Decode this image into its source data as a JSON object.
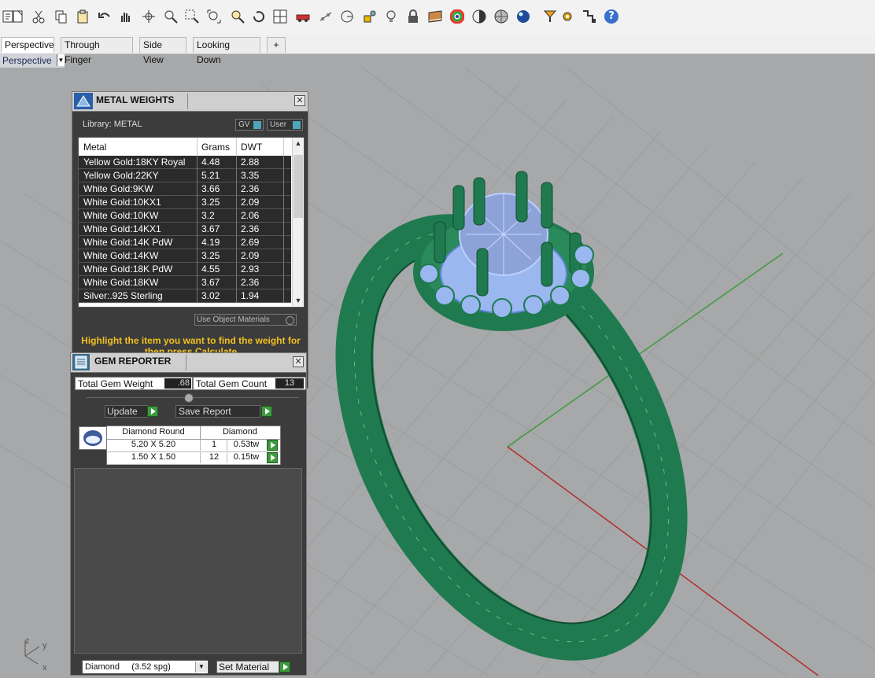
{
  "toolbar": {
    "icons": [
      "new-file-icon",
      "cut-icon",
      "copy-icon",
      "paste-icon",
      "undo-icon",
      "pan-icon",
      "rotate-icon",
      "zoom-icon",
      "zoom-window-icon",
      "zoom-extents-icon",
      "zoom-selected-icon",
      "rotate-view-icon",
      "grid-viewports-icon",
      "car-icon",
      "points-icon",
      "circle-icon",
      "shapes-icon",
      "lock-icon",
      "light-icon",
      "book-icon",
      "color-wheel-icon",
      "shade-icon",
      "render-sphere-icon",
      "gem-sphere-icon",
      "options-icon",
      "gear-icon",
      "flow-icon",
      "help-icon"
    ],
    "help_glyph": "?"
  },
  "tabs": [
    "Perspective",
    "Through Finger",
    "Side View",
    "Looking Down"
  ],
  "add_tab_glyph": "+",
  "viewport": {
    "label": "Perspective",
    "axis_y": "y",
    "axis_x": "x",
    "axis_z": "z"
  },
  "metal_weights": {
    "title": "METAL WEIGHTS",
    "library_label": "Library: METAL",
    "gv_label": "GV",
    "user_label": "User",
    "columns": [
      "Metal",
      "Grams",
      "DWT"
    ],
    "rows": [
      {
        "metal": "Yellow Gold:18KY Royal",
        "grams": "4.48",
        "dwt": "2.88"
      },
      {
        "metal": "Yellow Gold:22KY",
        "grams": "5.21",
        "dwt": "3.35"
      },
      {
        "metal": "White Gold:9KW",
        "grams": "3.66",
        "dwt": "2.36"
      },
      {
        "metal": "White Gold:10KX1",
        "grams": "3.25",
        "dwt": "2.09"
      },
      {
        "metal": "White Gold:10KW",
        "grams": "3.2",
        "dwt": "2.06"
      },
      {
        "metal": "White Gold:14KX1",
        "grams": "3.67",
        "dwt": "2.36"
      },
      {
        "metal": "White Gold:14K PdW",
        "grams": "4.19",
        "dwt": "2.69"
      },
      {
        "metal": "White Gold:14KW",
        "grams": "3.25",
        "dwt": "2.09"
      },
      {
        "metal": "White Gold:18K PdW",
        "grams": "4.55",
        "dwt": "2.93"
      },
      {
        "metal": "White Gold:18KW",
        "grams": "3.67",
        "dwt": "2.36"
      },
      {
        "metal": "Silver:.925 Sterling",
        "grams": "3.02",
        "dwt": "1.94"
      }
    ],
    "use_object_materials": "Use Object Materials",
    "hint": "Highlight the item you want to find the weight for then press Calculate"
  },
  "gem_reporter": {
    "title": "GEM REPORTER",
    "total_weight_label": "Total Gem Weight",
    "total_weight_value": ".68",
    "total_count_label": "Total Gem Count",
    "total_count_value": "13",
    "update_label": "Update",
    "save_report_label": "Save Report",
    "table_header_shape": "Diamond Round",
    "table_header_type": "Diamond",
    "rows": [
      {
        "size": "5.20 X 5.20",
        "count": "1",
        "weight": "0.53tw"
      },
      {
        "size": "1.50 X 1.50",
        "count": "12",
        "weight": "0.15tw"
      }
    ],
    "material_select": "Diamond     (3.52 spg)",
    "set_material_label": "Set Material"
  },
  "colors": {
    "ring_green": "#1f7a4f",
    "gem_blue": "#9ab7f0",
    "panel_dark": "#3c3c3c",
    "hint_yellow": "#f0c020",
    "viewport_gray": "#a7a8a9"
  }
}
